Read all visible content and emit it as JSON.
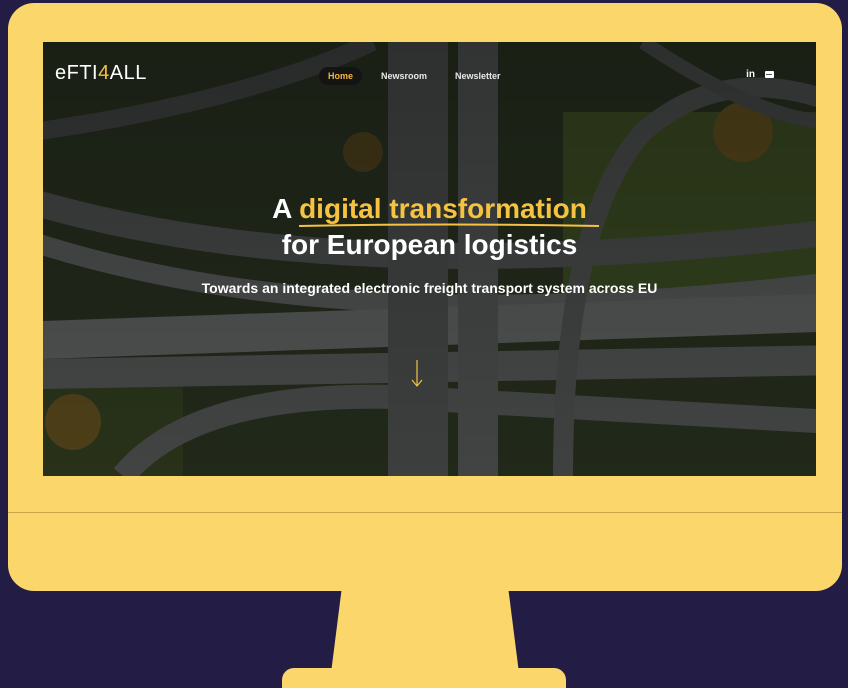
{
  "site": {
    "logo": {
      "prefix": "eFTI",
      "number": "4",
      "suffix": "ALL"
    }
  },
  "nav": {
    "items": [
      {
        "label": "Home",
        "active": true
      },
      {
        "label": "Newsroom",
        "active": false
      },
      {
        "label": "Newsletter",
        "active": false
      }
    ],
    "social": [
      "linkedin-icon",
      "mail-icon"
    ],
    "linkedin_label": "in"
  },
  "hero": {
    "headline_prefix": "A ",
    "headline_highlight": "digital transformation",
    "headline_line2": "for European logistics",
    "subline": "Towards an integrated electronic freight transport system across EU",
    "scroll_icon": "arrow-down-icon"
  },
  "colors": {
    "accent": "#f5c242",
    "monitor": "#fbd66a",
    "backdrop": "#231d45"
  }
}
